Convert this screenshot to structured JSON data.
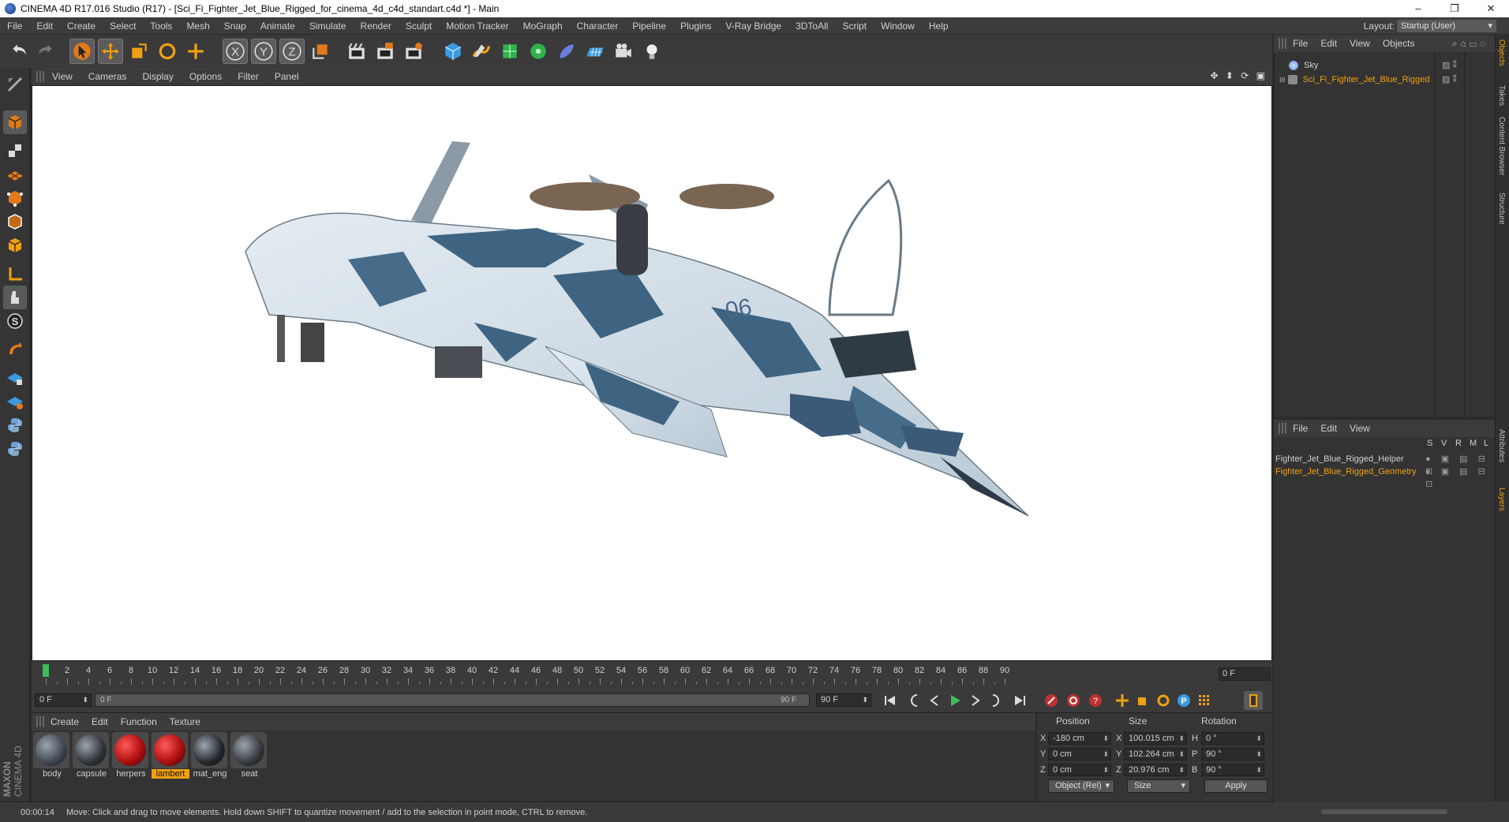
{
  "window": {
    "title": "CINEMA 4D R17.016 Studio (R17) - [Sci_Fi_Fighter_Jet_Blue_Rigged_for_cinema_4d_c4d_standart.c4d *] - Main",
    "controls": [
      "–",
      "❐",
      "✕"
    ]
  },
  "menu": [
    "File",
    "Edit",
    "Create",
    "Select",
    "Tools",
    "Mesh",
    "Snap",
    "Animate",
    "Simulate",
    "Render",
    "Sculpt",
    "Motion Tracker",
    "MoGraph",
    "Character",
    "Pipeline",
    "Plugins",
    "V-Ray Bridge",
    "3DToAll",
    "Script",
    "Window",
    "Help"
  ],
  "layout": {
    "label": "Layout:",
    "value": "Startup (User)"
  },
  "toolbar_icons": [
    "undo-icon",
    "redo-icon",
    "select-arrow-icon",
    "move-icon",
    "scale-icon",
    "rotate-icon",
    "live-select-icon",
    "x-axis-icon",
    "y-axis-icon",
    "z-axis-icon",
    "coordinate-system-icon",
    "render-view-icon",
    "render-picture-viewer-icon",
    "render-settings-icon",
    "cube-icon",
    "pen-spline-icon",
    "subdivision-icon",
    "cloner-icon",
    "deformer-icon",
    "floor-icon",
    "camera-icon",
    "light-icon"
  ],
  "toolbar_axes": {
    "x": "X",
    "y": "Y",
    "z": "Z"
  },
  "viewport": {
    "menu": [
      "View",
      "Cameras",
      "Display",
      "Options",
      "Filter",
      "Panel"
    ],
    "nav_icons": "✥ ⬍ ⟳ ▣",
    "model_label": "06"
  },
  "timeline": {
    "ticks": [
      0,
      2,
      4,
      6,
      8,
      10,
      12,
      14,
      16,
      18,
      20,
      22,
      24,
      26,
      28,
      30,
      32,
      34,
      36,
      38,
      40,
      42,
      44,
      46,
      48,
      50,
      52,
      54,
      56,
      58,
      60,
      62,
      64,
      66,
      68,
      70,
      72,
      74,
      76,
      78,
      80,
      82,
      84,
      86,
      88,
      90
    ],
    "current_frame": 0,
    "end_field": "0 F"
  },
  "transport": {
    "start_field": "0 F",
    "range_start": "0 F",
    "range_end": "90 F",
    "end_field": "90 F"
  },
  "materials": {
    "menu": [
      "Create",
      "Edit",
      "Function",
      "Texture"
    ],
    "items": [
      {
        "name": "body",
        "color": "#3d4650"
      },
      {
        "name": "capsule",
        "color": "#2e3236"
      },
      {
        "name": "herpers",
        "color": "#b01010"
      },
      {
        "name": "lambert",
        "color": "#b01010",
        "selected": true
      },
      {
        "name": "mat_eng",
        "color": "#22262a"
      },
      {
        "name": "seat",
        "color": "#34383c"
      }
    ]
  },
  "coordinates": {
    "headers": {
      "position": "Position",
      "size": "Size",
      "rotation": "Rotation"
    },
    "rows": [
      {
        "axis": "X",
        "pos": "-180 cm",
        "saxis": "X",
        "size": "100.015 cm",
        "raxis": "H",
        "rot": "0 °"
      },
      {
        "axis": "Y",
        "pos": "0 cm",
        "saxis": "Y",
        "size": "102.264 cm",
        "raxis": "P",
        "rot": "90 °"
      },
      {
        "axis": "Z",
        "pos": "0 cm",
        "saxis": "Z",
        "size": "20.976 cm",
        "raxis": "B",
        "rot": "90 °"
      }
    ],
    "mode": "Object (Rel)",
    "size_mode": "Size",
    "apply": "Apply"
  },
  "status": {
    "time": "00:00:14",
    "message": "Move: Click and drag to move elements. Hold down SHIFT to quantize movement / add to the selection in point mode, CTRL to remove."
  },
  "objects": {
    "menu": [
      "File",
      "Edit",
      "View",
      "Objects"
    ],
    "items": [
      {
        "name": "Sky",
        "color": "#cfcfcf"
      },
      {
        "name": "Sci_Fi_Fighter_Jet_Blue_Rigged",
        "color": "#f0a010"
      }
    ]
  },
  "layers": {
    "menu": [
      "File",
      "Edit",
      "View"
    ],
    "columns": [
      "S",
      "V",
      "R",
      "M",
      "L"
    ],
    "items": [
      {
        "name": "Fighter_Jet_Blue_Rigged_Helper",
        "color": "#cfcfcf"
      },
      {
        "name": "Fighter_Jet_Blue_Rigged_Geometry",
        "color": "#f0a010"
      }
    ]
  },
  "side_tabs": [
    "Objects",
    "Takes",
    "Content Browser",
    "Structure",
    "Attributes",
    "Layers"
  ],
  "brand": {
    "line1": "MAXON",
    "line2": "CINEMA 4D"
  }
}
